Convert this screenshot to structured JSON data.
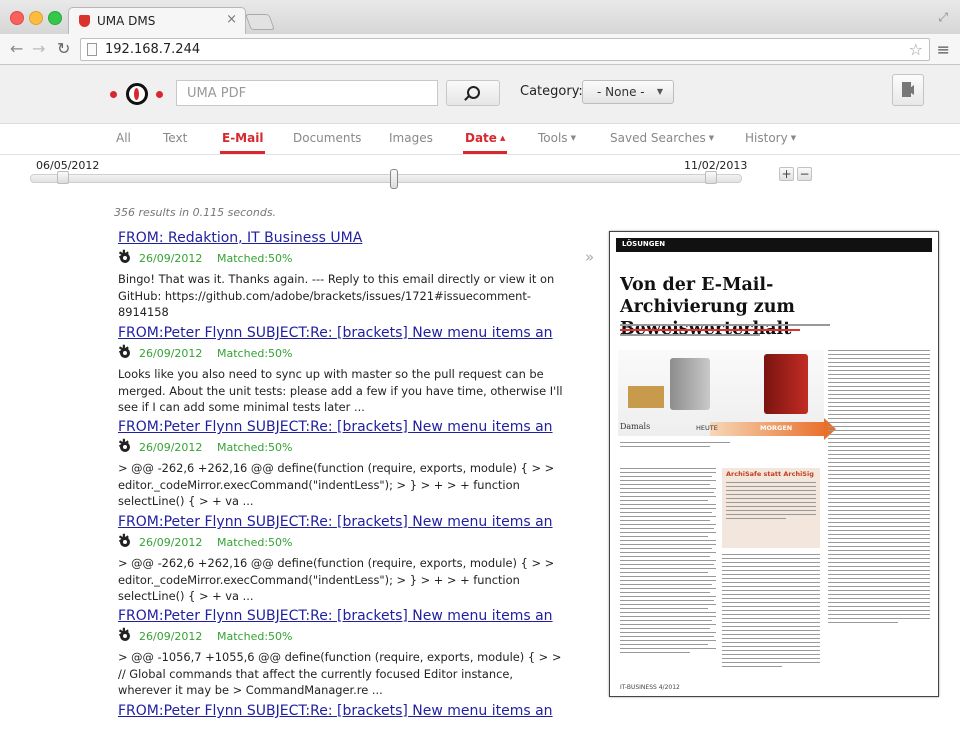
{
  "browser": {
    "tab_title": "UMA DMS",
    "tab_close": "×",
    "url": "192.168.7.244"
  },
  "header": {
    "search_placeholder": "UMA PDF",
    "category_label": "Category:",
    "category_value": "- None -"
  },
  "tabs": [
    {
      "label": "All"
    },
    {
      "label": "Text"
    },
    {
      "label": "E-Mail"
    },
    {
      "label": "Documents"
    },
    {
      "label": "Images"
    },
    {
      "label": "Date"
    },
    {
      "label": "Tools"
    },
    {
      "label": "Saved Searches"
    },
    {
      "label": "History"
    }
  ],
  "date_range": {
    "from": "06/05/2012",
    "to": "11/02/2013",
    "zoom_in": "+",
    "zoom_out": "−"
  },
  "results": {
    "summary": "356 results in 0.115 seconds.",
    "items": [
      {
        "title": "FROM: Redaktion, IT Business UMA",
        "date": "26/09/2012",
        "matched": "Matched:50%",
        "snippet": "Bingo! That was it. Thanks again.  --- Reply to this email directly or view it on GitHub: https://github.com/adobe/brackets/issues/1721#issuecomment-8914158"
      },
      {
        "title": "FROM:Peter Flynn SUBJECT:Re: [brackets] New menu items an",
        "date": "26/09/2012",
        "matched": "Matched:50%",
        "snippet": "Looks like you also need to sync up with master so the pull request can be merged.  About the unit tests: please add a few if you have time, otherwise I'll see if I can add some minimal tests later ..."
      },
      {
        "title": "FROM:Peter Flynn SUBJECT:Re: [brackets] New menu items an",
        "date": "26/09/2012",
        "matched": "Matched:50%",
        "snippet": "> @@ -262,6 +262,16 @@ define(function (require, exports, module) { > > editor._codeMirror.execCommand(\"indentLess\"); > } > + > + function selectLine() { > + va ..."
      },
      {
        "title": "FROM:Peter Flynn SUBJECT:Re: [brackets] New menu items an",
        "date": "26/09/2012",
        "matched": "Matched:50%",
        "snippet": "> @@ -262,6 +262,16 @@ define(function (require, exports, module) { > > editor._codeMirror.execCommand(\"indentLess\"); > } > + > + function selectLine() { > + va ..."
      },
      {
        "title": "FROM:Peter Flynn SUBJECT:Re: [brackets] New menu items an",
        "date": "26/09/2012",
        "matched": "Matched:50%",
        "snippet": "> @@ -1056,7 +1055,6 @@ define(function (require, exports, module) { > > // Global commands that affect the currently focused Editor instance, wherever it may be > CommandManager.re ..."
      },
      {
        "title": "FROM:Peter Flynn SUBJECT:Re: [brackets] New menu items an",
        "date": "",
        "matched": "",
        "snippet": ""
      }
    ]
  },
  "preview": {
    "expand_icon": "»",
    "section": "LÖSUNGEN",
    "headline": "Von der E-Mail-Archivierung zum Beweiswerterhalt",
    "label_left": "Damals",
    "label_mid": "HEUTE",
    "label_right": "MORGEN",
    "sidebar_heading": "ArchiSafe statt ArchiSig",
    "footer": "IT-BUSINESS 4/2012"
  },
  "colors": {
    "accent": "#d9272e",
    "link": "#1f1fa0",
    "matched": "#34a233"
  }
}
